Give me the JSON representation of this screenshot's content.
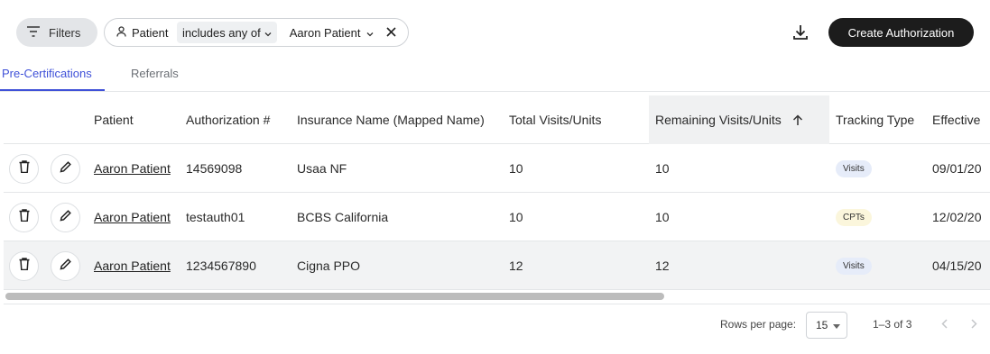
{
  "toolbar": {
    "filters_label": "Filters",
    "filter_chip": {
      "field": "Patient",
      "operator": "includes any of",
      "value": "Aaron Patient"
    },
    "create_label": "Create Authorization"
  },
  "tabs": [
    {
      "label": "Pre-Certifications",
      "active": true
    },
    {
      "label": "Referrals",
      "active": false
    }
  ],
  "table": {
    "columns": [
      "Patient",
      "Authorization #",
      "Insurance Name (Mapped Name)",
      "Total Visits/Units",
      "Remaining Visits/Units",
      "Tracking Type",
      "Effective"
    ],
    "rows": [
      {
        "patient": "Aaron Patient",
        "auth": "14569098",
        "insurance": "Usaa NF",
        "total": "10",
        "remaining": "10",
        "tracking": "Visits",
        "effective": "09/01/20"
      },
      {
        "patient": "Aaron Patient",
        "auth": "testauth01",
        "insurance": "BCBS California",
        "total": "10",
        "remaining": "10",
        "tracking": "CPTs",
        "effective": "12/02/20"
      },
      {
        "patient": "Aaron Patient",
        "auth": "1234567890",
        "insurance": "Cigna PPO",
        "total": "12",
        "remaining": "12",
        "tracking": "Visits",
        "effective": "04/15/20"
      }
    ]
  },
  "pagination": {
    "rows_label": "Rows per page:",
    "rows_value": "15",
    "range": "1–3 of 3"
  },
  "colors": {
    "accent": "#3f51d8",
    "visits_badge": "#e6ecf9",
    "cpts_badge": "#fbf6dc",
    "dark_button": "#1c1c1c"
  }
}
